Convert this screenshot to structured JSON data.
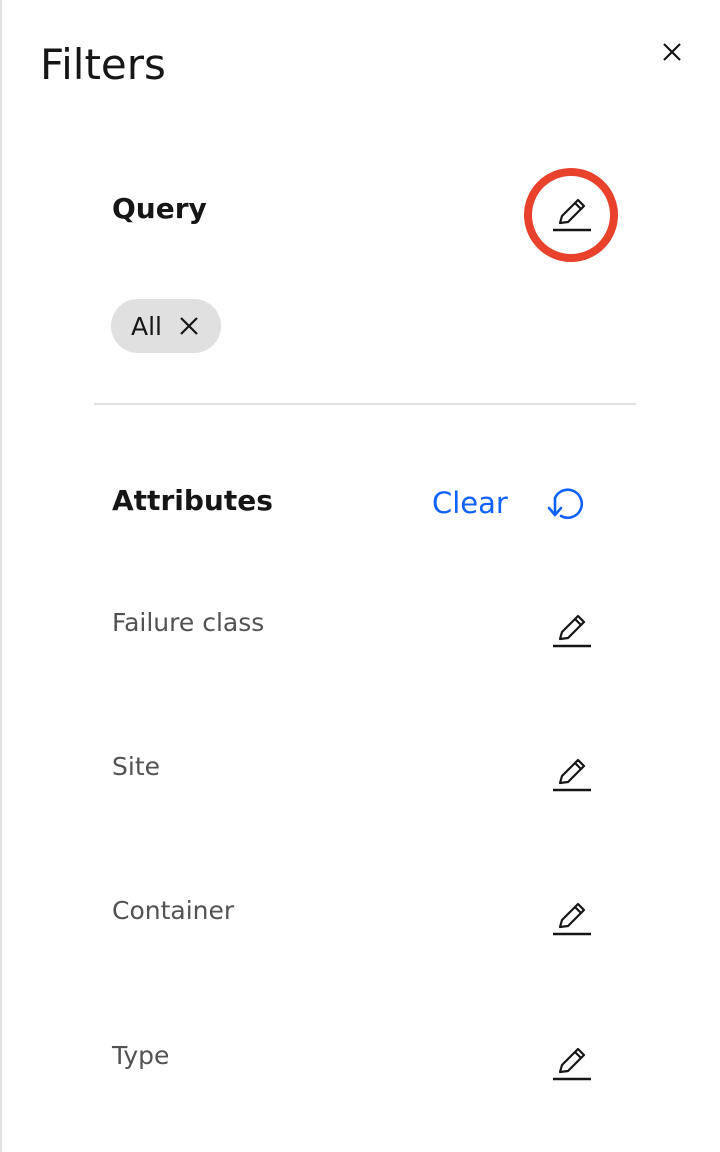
{
  "panel": {
    "title": "Filters"
  },
  "query": {
    "title": "Query",
    "tags": [
      {
        "label": "All"
      }
    ]
  },
  "attributes": {
    "title": "Attributes",
    "clear_label": "Clear",
    "items": [
      {
        "label": "Failure class"
      },
      {
        "label": "Site"
      },
      {
        "label": "Container"
      },
      {
        "label": "Type"
      }
    ]
  },
  "icons": {
    "close": "close-icon",
    "edit": "pencil-edit-icon",
    "tag_remove": "close-icon",
    "reset": "reset-icon"
  },
  "colors": {
    "link": "#0f62fe",
    "highlight": "#e8412c",
    "tag_bg": "#e0e0e0",
    "divider": "#e0e0e0",
    "text_primary": "#161616",
    "text_secondary": "#525252"
  }
}
